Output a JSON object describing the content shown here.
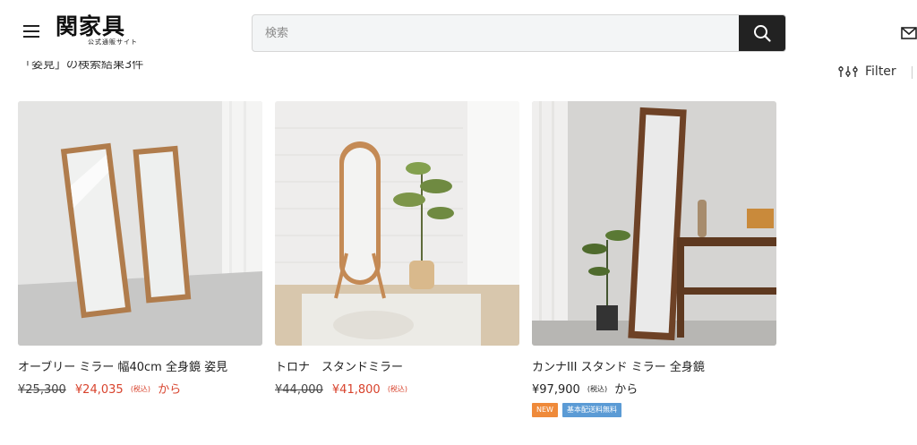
{
  "header": {
    "logo_text": "関家具",
    "logo_sub": "公式通販サイト",
    "search_placeholder": "検索"
  },
  "results": {
    "count_text": "「姿見」の検索結果3件",
    "filter_label": "Filter"
  },
  "colors": {
    "sale_price": "#d8432d",
    "badge_new": "#ef8a3a",
    "badge_shipping": "#5b9bd5",
    "search_button": "#222222"
  },
  "products": [
    {
      "title": "オーブリー ミラー 幅40cm 全身鏡 姿見",
      "old_price": "¥25,300",
      "price": "¥24,035",
      "tax": "(税込)",
      "suffix": "から"
    },
    {
      "title": "トロナ　スタンドミラー",
      "old_price": "¥44,000",
      "price": "¥41,800",
      "tax": "(税込)",
      "suffix": ""
    },
    {
      "title": "カンナIII スタンド ミラー 全身鏡",
      "price": "¥97,900",
      "tax": "(税込)",
      "suffix": "から",
      "badges": [
        "NEW",
        "基本配送料無料"
      ]
    }
  ]
}
